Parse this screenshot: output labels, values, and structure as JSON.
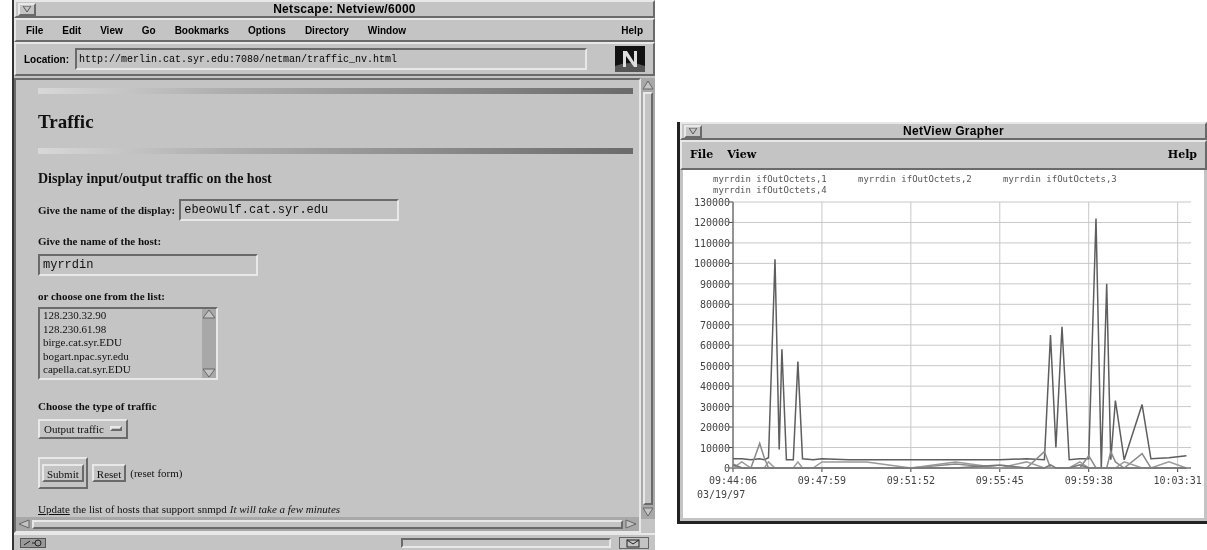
{
  "browser": {
    "title": "Netscape: Netview/6000",
    "menu": [
      "File",
      "Edit",
      "View",
      "Go",
      "Bookmarks",
      "Options",
      "Directory",
      "Window"
    ],
    "help": "Help",
    "location_label": "Location:",
    "url": "http://merlin.cat.syr.edu:7080/netman/traffic_nv.html",
    "page": {
      "heading": "Traffic",
      "subheading": "Display input/output traffic on the host",
      "display_label": "Give the name of the display:",
      "display_value": "ebeowulf.cat.syr.edu",
      "host_label": "Give the name of the host:",
      "host_value": "myrrdin",
      "list_label": "or choose one from the list:",
      "hosts": [
        {
          "label": "128.230.32.90",
          "selected": false
        },
        {
          "label": "128.230.61.98",
          "selected": false
        },
        {
          "label": "birge.cat.syr.EDU",
          "selected": false
        },
        {
          "label": "bogart.npac.syr.edu",
          "selected": false
        },
        {
          "label": "capella.cat.syr.EDU",
          "selected": false
        }
      ],
      "traffic_label": "Choose the type of traffic",
      "traffic_value": "Output traffic",
      "submit": "Submit",
      "reset": "Reset",
      "reset_note": "(reset form)",
      "update_link": "Update",
      "update_text": "the list of hosts that support snmpd",
      "update_note": "It will take a few minutes"
    }
  },
  "grapher": {
    "title": "NetView Grapher",
    "menu": [
      "File",
      "View"
    ],
    "help": "Help",
    "date_label": "03/19/97",
    "chart_data": {
      "type": "line",
      "grid": true,
      "x": [
        35046,
        35069,
        35093,
        35116,
        35128,
        35139,
        35156,
        35167,
        35174,
        35186,
        35204,
        35216,
        35228,
        35256,
        35279,
        35349,
        35396,
        35512,
        35629,
        35745,
        35815,
        35862,
        35878,
        35892,
        35908,
        35927,
        35955,
        35978,
        35997,
        36011,
        36025,
        36036,
        36048,
        36071,
        36118,
        36141,
        36188,
        36234
      ],
      "series": [
        {
          "name": "myrrdin ifOutOctets,1",
          "color": "#5e5e5e",
          "values": [
            4500,
            4500,
            4000,
            4500,
            4000,
            5000,
            102000,
            9000,
            58000,
            4000,
            4000,
            52000,
            4500,
            4000,
            4500,
            4000,
            4000,
            4000,
            4000,
            4000,
            4500,
            4000,
            65000,
            10000,
            69000,
            4000,
            4500,
            4500,
            122000,
            0,
            90000,
            4000,
            33000,
            4000,
            31000,
            4500,
            5000,
            6000
          ]
        },
        {
          "name": "myrrdin ifOutOctets,2",
          "color": "#8a8a8a",
          "values": [
            2000,
            0,
            0,
            12000,
            5000,
            0,
            0,
            0,
            0,
            0,
            0,
            0,
            0,
            0,
            0,
            0,
            0,
            0,
            2000,
            0,
            0,
            8000,
            0,
            0,
            0,
            0,
            0,
            6000,
            0,
            0,
            0,
            8000,
            3000,
            0,
            7000,
            0,
            0,
            0
          ]
        },
        {
          "name": "myrrdin ifOutOctets,3",
          "color": "#9a9a9a",
          "values": [
            0,
            3000,
            0,
            0,
            0,
            3000,
            0,
            0,
            0,
            0,
            0,
            3000,
            0,
            0,
            3000,
            3000,
            3000,
            0,
            3000,
            0,
            3000,
            0,
            0,
            0,
            0,
            0,
            3000,
            0,
            0,
            0,
            0,
            0,
            0,
            3000,
            0,
            0,
            3000,
            0
          ]
        },
        {
          "name": "myrrdin ifOutOctets,4",
          "color": "#767676",
          "values": [
            1500,
            0,
            0,
            0,
            0,
            0,
            0,
            0,
            0,
            0,
            0,
            0,
            0,
            0,
            0,
            0,
            0,
            0,
            0,
            1500,
            0,
            0,
            1500,
            0,
            0,
            0,
            1500,
            0,
            0,
            0,
            0,
            0,
            0,
            0,
            0,
            0,
            0,
            0
          ]
        }
      ],
      "xlim": [
        35046,
        36246
      ],
      "ylim": [
        0,
        130000
      ],
      "xticks": [
        {
          "value": 35046,
          "label": "09:44:06"
        },
        {
          "value": 35279,
          "label": "09:47:59"
        },
        {
          "value": 35512,
          "label": "09:51:52"
        },
        {
          "value": 35745,
          "label": "09:55:45"
        },
        {
          "value": 35978,
          "label": "09:59:38"
        },
        {
          "value": 36211,
          "label": "10:03:31"
        }
      ],
      "yticks": [
        0,
        10000,
        20000,
        30000,
        40000,
        50000,
        60000,
        70000,
        80000,
        90000,
        100000,
        110000,
        120000,
        130000
      ]
    }
  }
}
